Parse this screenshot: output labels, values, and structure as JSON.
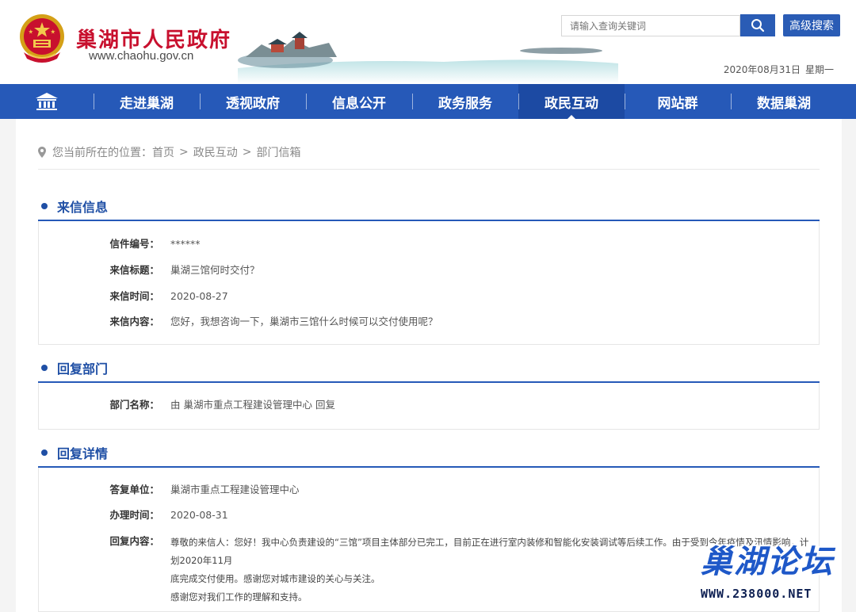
{
  "header": {
    "site_title": "巢湖市人民政府",
    "site_url": "www.chaohu.gov.cn",
    "search_placeholder": "请输入查询关键词",
    "advanced_search_label": "高级搜索",
    "date": "2020年08月31日",
    "weekday": "星期一"
  },
  "nav": {
    "items": [
      "走进巢湖",
      "透视政府",
      "信息公开",
      "政务服务",
      "政民互动",
      "网站群",
      "数据巢湖"
    ],
    "active": "政民互动"
  },
  "breadcrumb": {
    "prefix": "您当前所在的位置：",
    "items": [
      "首页",
      "政民互动",
      "部门信箱"
    ],
    "separator": ">"
  },
  "letter_info": {
    "title": "来信信息",
    "number_label": "信件编号：",
    "number_value": "******",
    "subject_label": "来信标题：",
    "subject_value": "巢湖三馆何时交付？",
    "time_label": "来信时间：",
    "time_value": "2020-08-27",
    "content_label": "来信内容：",
    "content_value": "您好，我想咨询一下，巢湖市三馆什么时候可以交付使用呢？"
  },
  "reply_dept": {
    "title": "回复部门",
    "name_label": "部门名称：",
    "name_value": "由 巢湖市重点工程建设管理中心 回复"
  },
  "reply_detail": {
    "title": "回复详情",
    "unit_label": "答复单位：",
    "unit_value": "巢湖市重点工程建设管理中心",
    "time_label": "办理时间：",
    "time_value": "2020-08-31",
    "content_label": "回复内容：",
    "content_line1": "尊敬的来信人：您好！我中心负责建设的“三馆”项目主体部分已完工，目前正在进行室内装修和智能化安装调试等后续工作。由于受到今年疫情及汛情影响，计划2020年11月",
    "content_line2": "底完成交付使用。感谢您对城市建设的关心与关注。",
    "content_line3": "感谢您对我们工作的理解和支持。"
  },
  "watermark": {
    "title": "巢湖论坛",
    "url": "WWW.238000.NET"
  },
  "colors": {
    "brand_red": "#c8102e",
    "nav_blue": "#2659b8",
    "section_blue": "#1f4fa5"
  }
}
